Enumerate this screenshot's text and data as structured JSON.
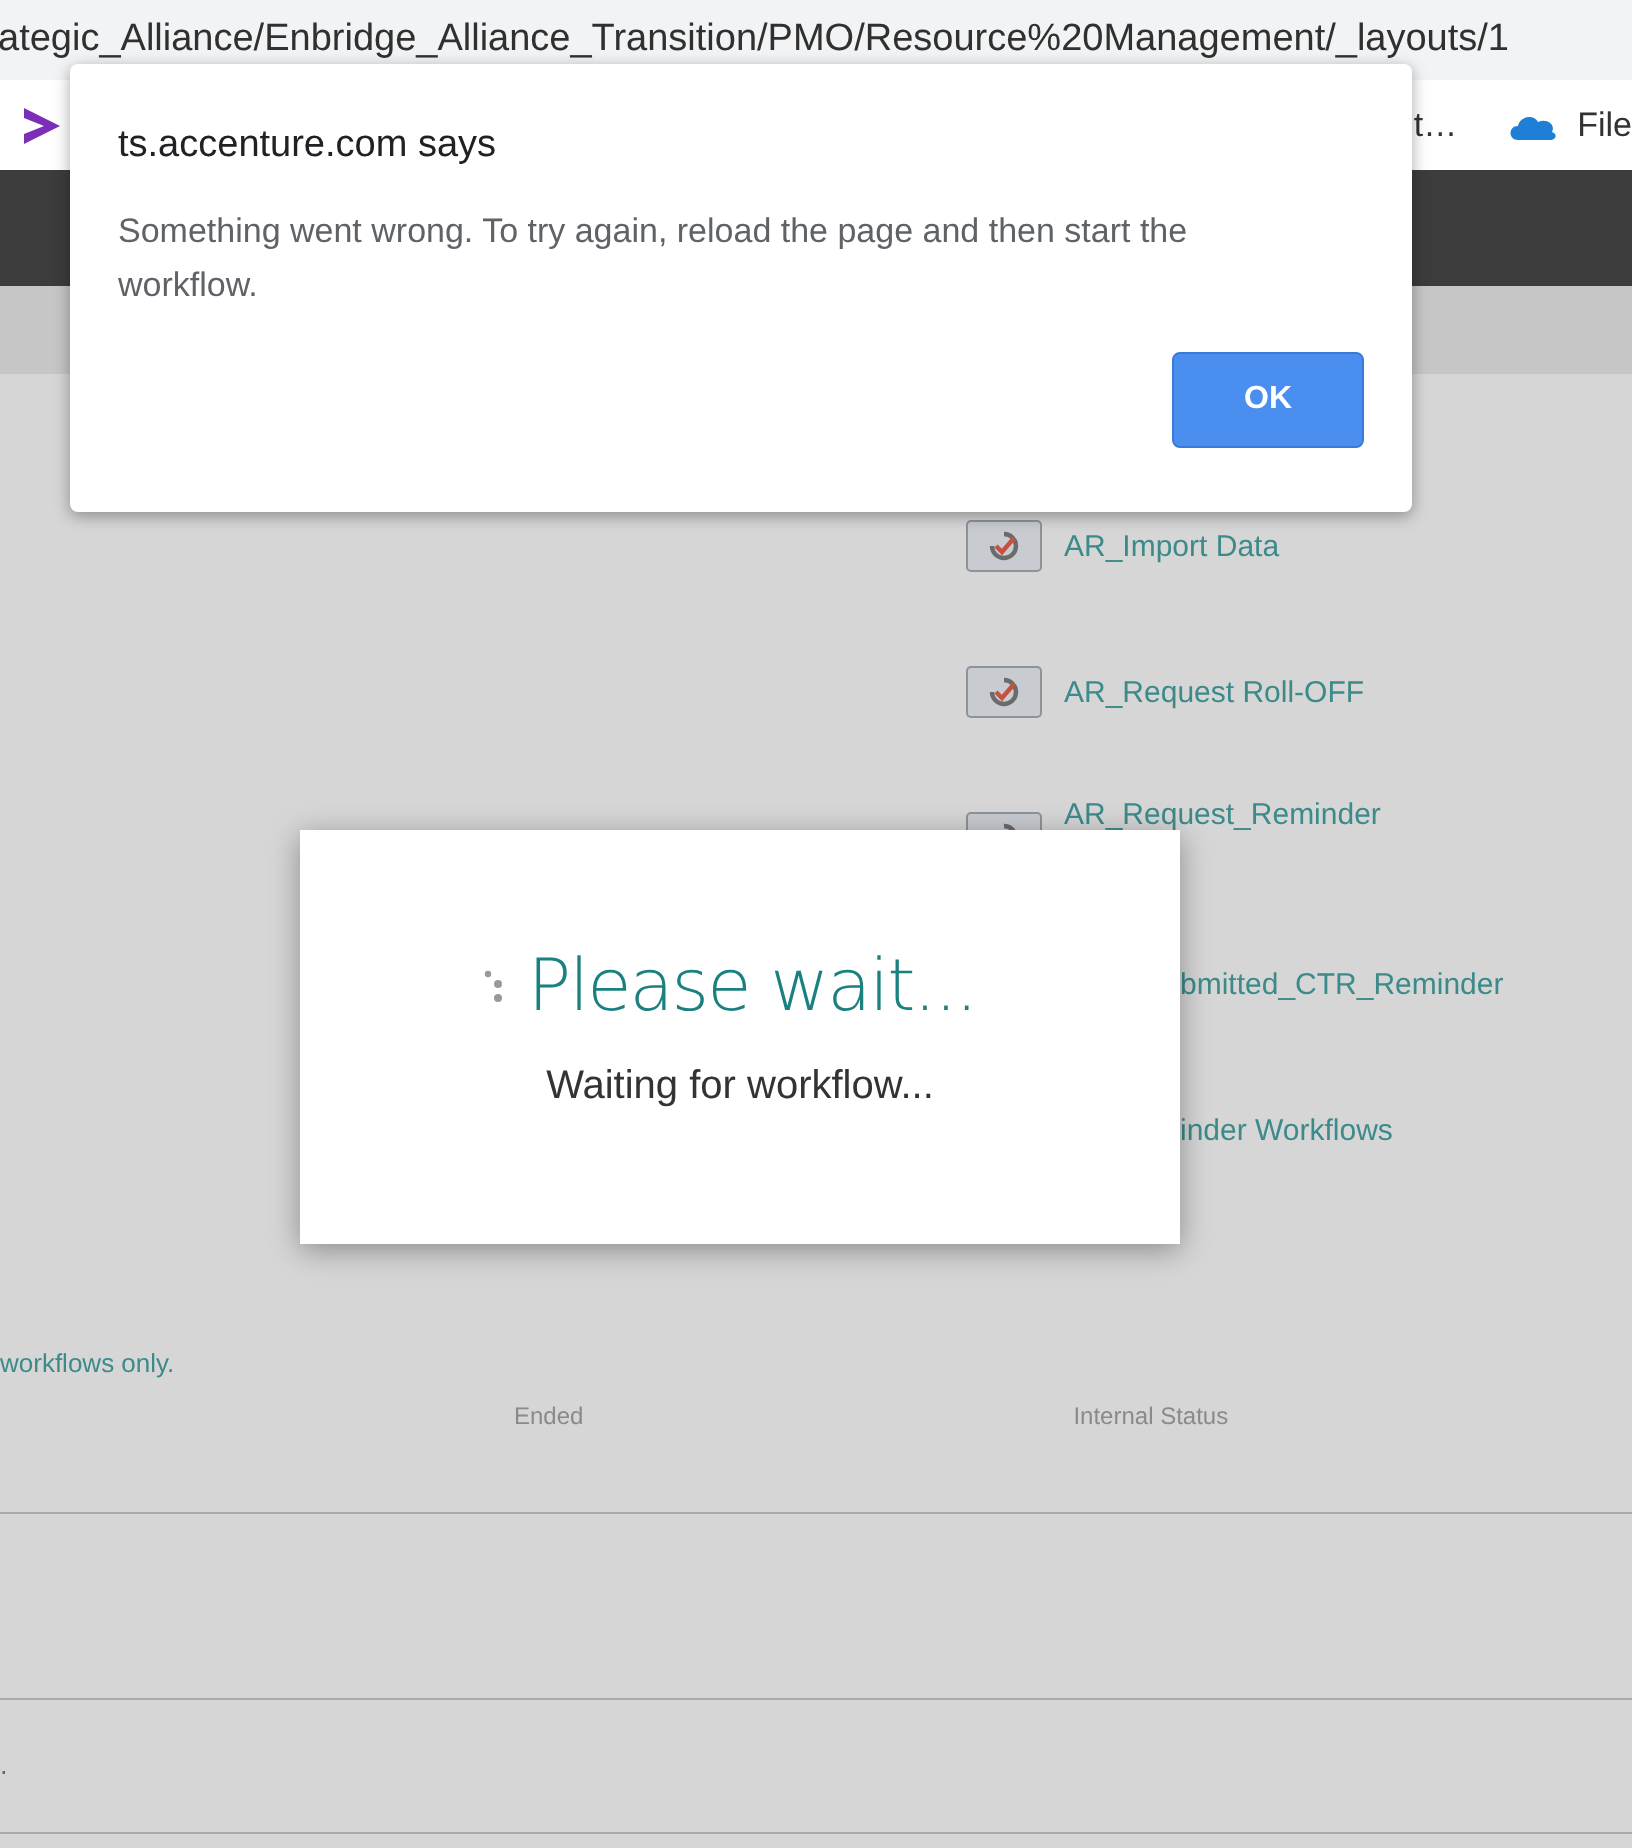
{
  "browser": {
    "address": "ategic_Alliance/Enbridge_Alliance_Transition/PMO/Resource%20Management/_layouts/1",
    "bookmarks": [
      {
        "label": "t…",
        "icon": false
      },
      {
        "label": "File",
        "icon": true
      }
    ]
  },
  "workflows": [
    {
      "name": "AR_Import Data",
      "icon": true
    },
    {
      "name": "AR_Request Roll-OFF",
      "icon": true
    },
    {
      "name": "AR_Request_Reminder",
      "icon": true
    },
    {
      "name": "bmitted_CTR_Reminder",
      "icon": false
    },
    {
      "name": "inder Workflows",
      "icon": false
    }
  ],
  "note": "workflows only.",
  "table": {
    "columns": [
      "Ended",
      "Internal Status"
    ],
    "rows": [
      {
        "cell": ""
      },
      {
        "cell": "."
      }
    ]
  },
  "alert": {
    "title": "ts.accenture.com says",
    "message": "Something went wrong. To try again, reload the page and then start the workflow.",
    "button": "OK"
  },
  "wait": {
    "title": "Please wait...",
    "message": "Waiting for workflow..."
  }
}
